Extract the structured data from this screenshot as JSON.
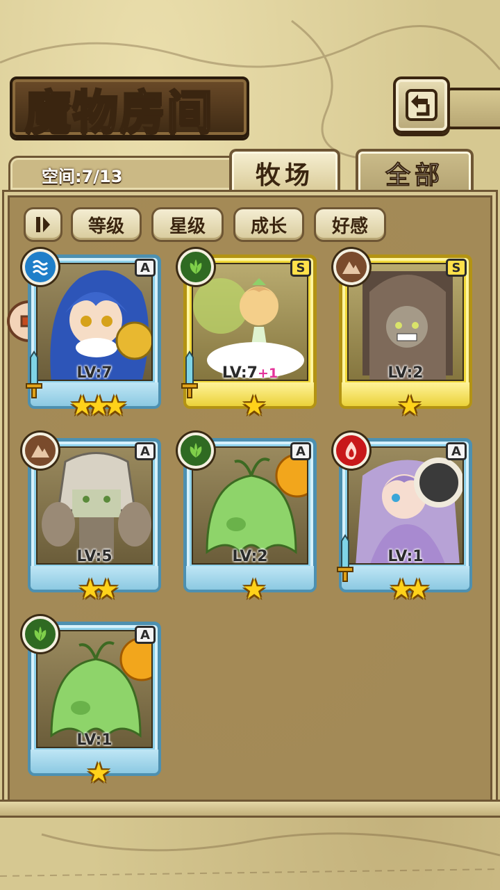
{
  "header": {
    "title": "魔物房间",
    "back_icon": "back-arrow-icon"
  },
  "storage": {
    "label": "空间:7/13"
  },
  "tabs": [
    {
      "label": "牧场",
      "active": true
    },
    {
      "label": "全部",
      "active": false
    }
  ],
  "sort": {
    "toggle_icon": "pause-icon",
    "buttons": [
      {
        "label": "等级"
      },
      {
        "label": "星级"
      },
      {
        "label": "成长"
      },
      {
        "label": "好感"
      }
    ]
  },
  "monsters": [
    {
      "element": "water",
      "rank": "A",
      "level": "LV:7",
      "level_bonus": "",
      "stars": "★★★",
      "frame": "blue",
      "equipped": true
    },
    {
      "element": "wood",
      "rank": "S",
      "level": "LV:7",
      "level_bonus": "+1",
      "stars": "★",
      "frame": "gold",
      "equipped": true
    },
    {
      "element": "earth",
      "rank": "S",
      "level": "LV:2",
      "level_bonus": "",
      "stars": "★",
      "frame": "gold",
      "equipped": false
    },
    {
      "element": "earth",
      "rank": "A",
      "level": "LV:5",
      "level_bonus": "",
      "stars": "★★",
      "frame": "blue",
      "equipped": false
    },
    {
      "element": "wood",
      "rank": "A",
      "level": "LV:2",
      "level_bonus": "",
      "stars": "★",
      "frame": "blue",
      "equipped": false
    },
    {
      "element": "fire",
      "rank": "A",
      "level": "LV:1",
      "level_bonus": "",
      "stars": "★★",
      "frame": "blue",
      "equipped": true
    },
    {
      "element": "wood",
      "rank": "A",
      "level": "LV:1",
      "level_bonus": "",
      "stars": "★",
      "frame": "blue",
      "equipped": false
    }
  ],
  "colors": {
    "water": "#1f7fc9",
    "wood": "#2f6a22",
    "earth": "#7a4b2c",
    "fire": "#c8181a",
    "gold_frame": "#f0d83a",
    "blue_frame": "#8ed1ea"
  }
}
